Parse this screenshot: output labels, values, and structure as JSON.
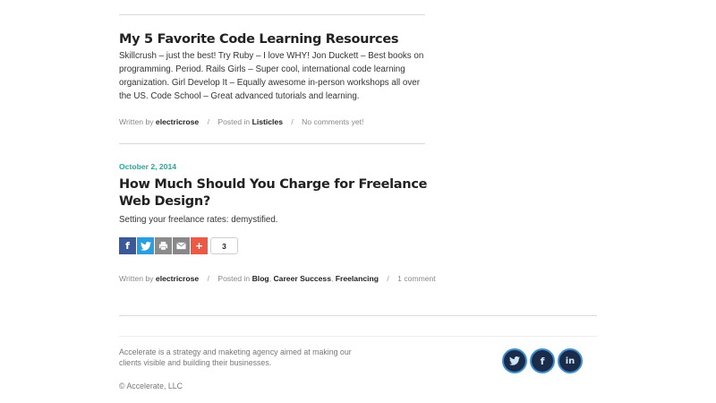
{
  "posts": [
    {
      "title": "My 5 Favorite Code Learning Resources",
      "excerpt": "Skillcrush – just the best! Try Ruby – I love WHY! Jon Duckett – Best books on programming. Period. Rails Girls – Super cool, international code learning organization. Girl Develop It – Equally awesome in-person workshops all over the US. Code School – Great advanced tutorials and learning.",
      "written_by_label": "Written by",
      "author": "electricrose",
      "posted_in_label": "Posted in",
      "categories": [
        "Listicles"
      ],
      "comments": "No comments yet!"
    },
    {
      "date": "October 2, 2014",
      "title": "How Much Should You Charge for Freelance Web Design?",
      "excerpt": "Setting your freelance rates: demystified.",
      "written_by_label": "Written by",
      "author": "electricrose",
      "posted_in_label": "Posted in",
      "categories": [
        "Blog",
        "Career Success",
        "Freelancing"
      ],
      "comments": "1 comment",
      "share": {
        "buttons": [
          "facebook-icon",
          "twitter-icon",
          "print-icon",
          "email-icon",
          "plus-icon"
        ],
        "count": "3"
      }
    }
  ],
  "footer": {
    "about": "Accelerate is a strategy and maketing agency aimed at making our clients visible and building their businesses.",
    "copyright": "© Accelerate, LLC",
    "social": [
      "twitter-icon",
      "facebook-icon",
      "linkedin-icon"
    ]
  },
  "colors": {
    "accent": "#2aa59c",
    "facebook": "#3b5998",
    "twitter": "#2a9fe0",
    "plus": "#ea5a44",
    "social_circle": "#1b2c4a"
  }
}
